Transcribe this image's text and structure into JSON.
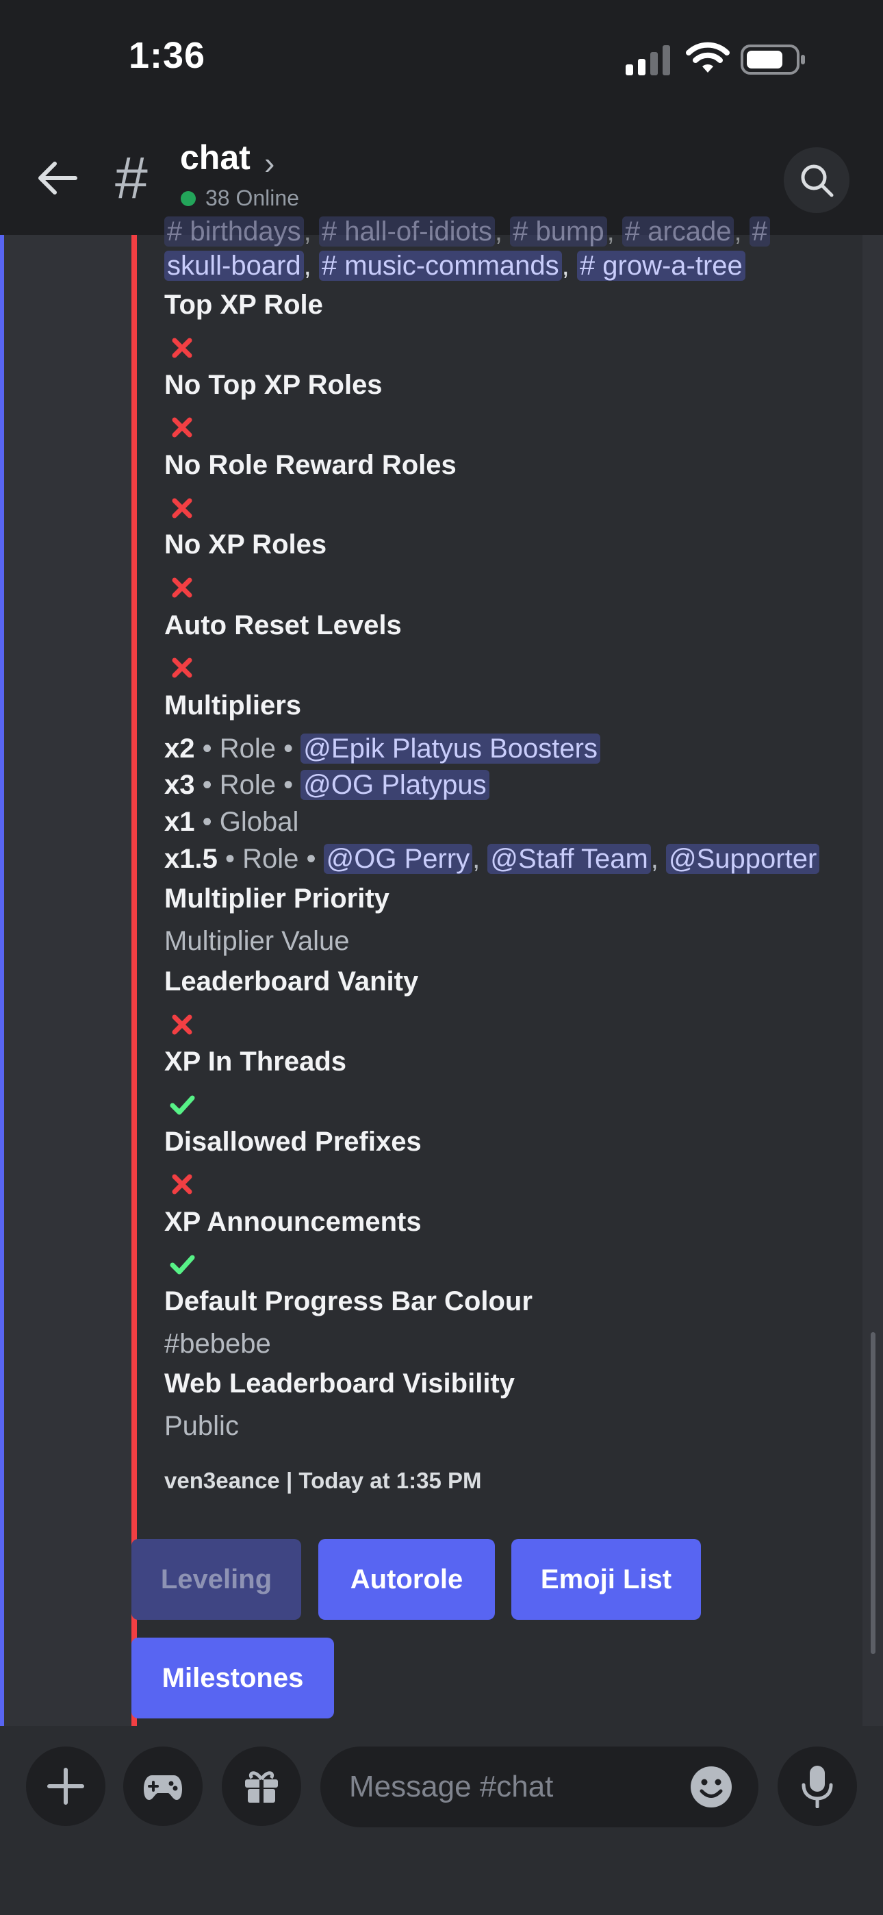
{
  "status_bar": {
    "time": "1:36"
  },
  "header": {
    "channel_name": "chat",
    "online_text": "38 Online"
  },
  "embed": {
    "channels_line1": [
      "birthdays",
      "hall-of-idiots",
      "bump",
      "arcade",
      "#"
    ],
    "channels_line2": [
      "skull-board",
      "music-commands",
      "grow-a-tree"
    ],
    "fields": {
      "top_xp_role": "Top XP Role",
      "no_top_xp_roles": "No Top XP Roles",
      "no_role_reward_roles": "No Role Reward Roles",
      "no_xp_roles": "No XP Roles",
      "auto_reset_levels": "Auto Reset Levels",
      "multipliers": "Multipliers",
      "multiplier_priority": "Multiplier Priority",
      "multiplier_priority_value": "Multiplier Value",
      "leaderboard_vanity": "Leaderboard Vanity",
      "xp_in_threads": "XP In Threads",
      "disallowed_prefixes": "Disallowed Prefixes",
      "xp_announcements": "XP Announcements",
      "default_progress_bar_colour": "Default Progress Bar Colour",
      "default_progress_bar_colour_value": "#bebebe",
      "web_leaderboard_visibility": "Web Leaderboard Visibility",
      "web_leaderboard_visibility_value": "Public"
    },
    "multipliers": [
      {
        "factor": "x2",
        "scope": "Role",
        "mentions": [
          "@Epik Platyus Boosters"
        ]
      },
      {
        "factor": "x3",
        "scope": "Role",
        "mentions": [
          "@OG Platypus"
        ]
      },
      {
        "factor": "x1",
        "scope": "Global",
        "mentions": []
      },
      {
        "factor": "x1.5",
        "scope": "Role",
        "mentions": [
          "@OG Perry",
          "@Staff Team",
          "@Supporter"
        ]
      }
    ],
    "separator": "•",
    "footer": "ven3eance | Today at 1:35 PM"
  },
  "buttons": {
    "leveling": "Leveling",
    "autorole": "Autorole",
    "emoji_list": "Emoji List",
    "milestones": "Milestones"
  },
  "composer": {
    "placeholder": "Message #chat"
  },
  "colors": {
    "accent": "#5865f2",
    "embed_border": "#f23f43",
    "online": "#23a55a",
    "cross": "#f23f43",
    "check": "#57f287"
  }
}
